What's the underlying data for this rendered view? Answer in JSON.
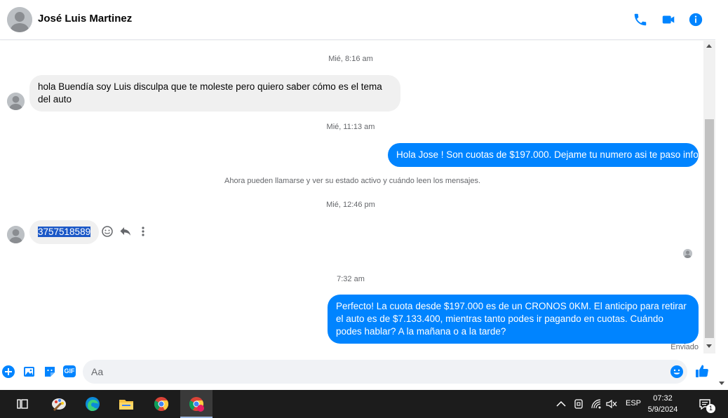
{
  "header": {
    "contact_name": "José Luis Martinez",
    "icons": [
      "avatar",
      "phone-icon",
      "video-call-icon",
      "info-icon"
    ]
  },
  "thread": {
    "ts1": "Mié, 8:16 am",
    "msg1": "hola Buendía soy Luis disculpa que te moleste pero quiero saber cómo es el tema del auto",
    "ts2": "Mié, 11:13 am",
    "msg2": "Hola Jose ! Son cuotas de $197.000. Dejame tu numero asi te paso info",
    "system_notice": "Ahora pueden llamarse y ver su estado activo y cuándo leen los mensajes.",
    "ts3": "Mié, 12:46 pm",
    "msg3": "3757518589",
    "ts4": "7:32 am",
    "msg4": "Perfecto! La cuota desde $197.000 es de un CRONOS 0KM. El anticipo para retirar el auto es de $7.133.400, mientras tanto podes ir pagando en cuotas. Cuándo podes hablar? A la mañana o a la tarde?",
    "status": "Enviado"
  },
  "composer": {
    "placeholder": "Aa",
    "icons": [
      "add-icon",
      "photo-icon",
      "sticker-icon",
      "gif-icon",
      "emoji-icon",
      "like-icon"
    ],
    "gif_label": "GIF"
  },
  "taskbar": {
    "apps": [
      "task-view-icon",
      "paint-icon",
      "edge-icon",
      "file-explorer-icon",
      "chrome-icon",
      "chrome-profile-icon"
    ],
    "lang": "ESP",
    "time": "07:32",
    "date": "5/9/2024",
    "notifications": "1"
  },
  "colors": {
    "accent": "#0084ff",
    "incoming_bubble": "#f0f0f0",
    "taskbar": "#1c1c1c"
  }
}
